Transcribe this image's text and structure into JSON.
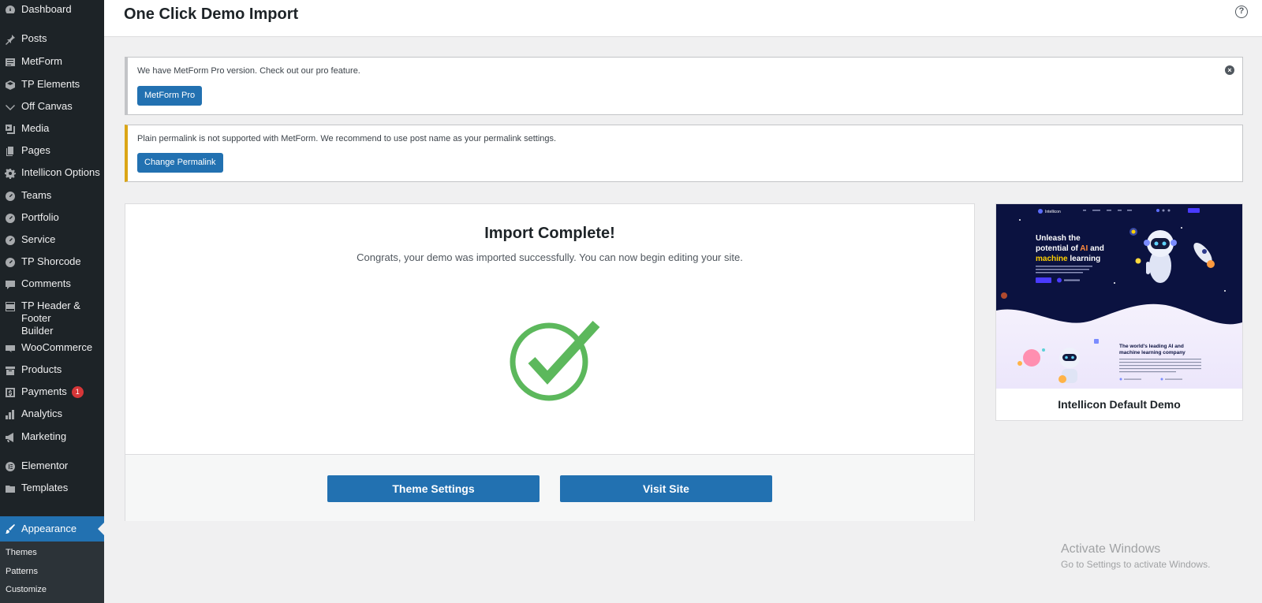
{
  "sidebar": {
    "items": [
      {
        "label": "Dashboard",
        "icon": "dashboard-icon"
      },
      {
        "label": "Posts",
        "icon": "pin-icon"
      },
      {
        "label": "MetForm",
        "icon": "form-icon"
      },
      {
        "label": "TP Elements",
        "icon": "elements-icon"
      },
      {
        "label": "Off Canvas",
        "icon": "chevron-down-icon"
      },
      {
        "label": "Media",
        "icon": "media-icon"
      },
      {
        "label": "Pages",
        "icon": "pages-icon"
      },
      {
        "label": "Intellicon Options",
        "icon": "gear-icon"
      },
      {
        "label": "Teams",
        "icon": "pin-circle-icon"
      },
      {
        "label": "Portfolio",
        "icon": "pin-circle-icon"
      },
      {
        "label": "Service",
        "icon": "pin-circle-icon"
      },
      {
        "label": "TP Shorcode",
        "icon": "pin-circle-icon"
      },
      {
        "label": "Comments",
        "icon": "comment-icon"
      },
      {
        "label": "TP Header & Footer Builder",
        "icon": "header-footer-icon"
      },
      {
        "label": "WooCommerce",
        "icon": "woo-icon"
      },
      {
        "label": "Products",
        "icon": "archive-icon"
      },
      {
        "label": "Payments",
        "icon": "dollar-icon",
        "badge": "1"
      },
      {
        "label": "Analytics",
        "icon": "bar-chart-icon"
      },
      {
        "label": "Marketing",
        "icon": "megaphone-icon"
      },
      {
        "label": "Elementor",
        "icon": "elementor-icon"
      },
      {
        "label": "Templates",
        "icon": "folder-icon"
      }
    ],
    "active": {
      "label": "Appearance",
      "icon": "paintbrush-icon"
    },
    "submenu": [
      "Themes",
      "Patterns",
      "Customize"
    ]
  },
  "header": {
    "title": "One Click Demo Import",
    "help": "?"
  },
  "notices": {
    "pro": {
      "text": "We have MetForm Pro version. Check out our pro feature.",
      "button": "MetForm Pro",
      "dismiss": "×"
    },
    "permalink": {
      "text": "Plain permalink is not supported with MetForm. We recommend to use post name as your permalink settings.",
      "button": "Change Permalink"
    }
  },
  "import": {
    "title": "Import Complete!",
    "subtitle": "Congrats, your demo was imported successfully. You can now begin editing your site.",
    "theme_settings_label": "Theme Settings",
    "visit_site_label": "Visit Site",
    "check_color": "#5cb85c"
  },
  "demo": {
    "name": "Intellicon Default Demo",
    "thumb": {
      "brand": "Intellicon",
      "hero_line1": "Unleash the",
      "hero_line2a": "potential of ",
      "hero_line2b": "AI",
      "hero_line2c": " and",
      "hero_line3a": "machine",
      "hero_line3b": " learning",
      "section2_line1": "The world's leading AI and",
      "section2_line2": "machine learning company"
    }
  },
  "watermark": {
    "title": "Activate Windows",
    "subtitle": "Go to Settings to activate Windows."
  },
  "colors": {
    "sidebar_bg": "#1d2327",
    "accent": "#2271b1",
    "warning": "#dba617",
    "badge": "#d63638"
  }
}
